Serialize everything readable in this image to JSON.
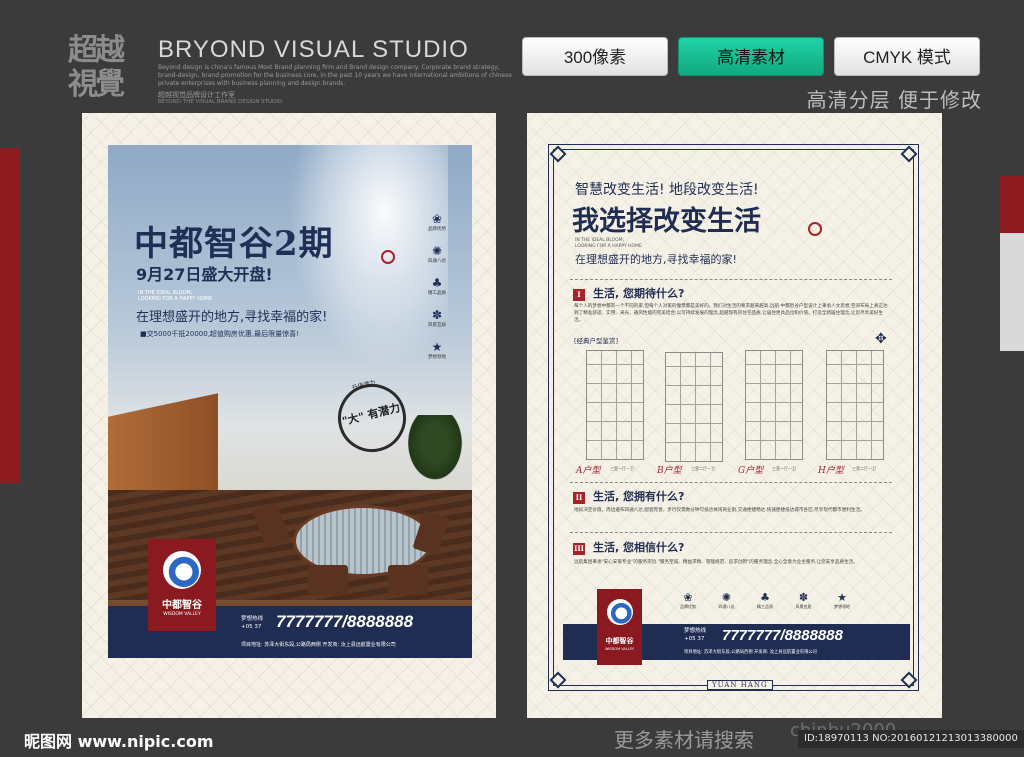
{
  "header": {
    "logo_text": "超越視覺",
    "studio_name": "BRYOND VISUAL STUDIO",
    "studio_desc": "Beyond design is china's famous Most Brand planning firm and Brand design company. Corporate brand strategy, brand-design, brand promotion for the business core, in the past 10 years we have international ambitions of chinese private enterprises with business planning and design brands.",
    "studio_cn": "超越视觉品牌设计工作室",
    "studio_en2": "BEYOND THE VISUAL BRAND DESIGN STUDIO",
    "buttons": [
      "300像素",
      "高清素材",
      "CMYK 模式"
    ],
    "tagline": "高清分层  便于修改"
  },
  "left_poster": {
    "title": "中都智谷2期",
    "subtitle": "9月27日盛大开盘!",
    "en": "IN THE IDEAL BLOOM,\nLOOKING FOR A HAPPY HOME",
    "slogan": "在理想盛开的地方,寻找幸福的家!",
    "small_text": "■交5000千抵20000,超值购房优惠,最后限量惊喜!",
    "icons": [
      {
        "glyph": "❀",
        "caption": "品牌优势"
      },
      {
        "glyph": "✺",
        "caption": "四通八达"
      },
      {
        "glyph": "♣",
        "caption": "精工品质"
      },
      {
        "glyph": "✽",
        "caption": "风景宜居"
      },
      {
        "glyph": "★",
        "caption": "梦想领地"
      }
    ],
    "stamp_top": "升值潜力",
    "stamp_main": "\"大\" 有潜力",
    "brand_cn": "中都智谷",
    "brand_en": "WISDOM VALLEY",
    "hotline_label": "梦想热线",
    "area_code": "+05 37",
    "phone": "7777777/8888888",
    "address": "项目地址:  苏泽大街东段,公路局西侧   开发商:  汝上县远航置业有限公司"
  },
  "right_poster": {
    "top_line": "智慧改变生活!  地段改变生活!",
    "title": "我选择改变生活",
    "en": "IN THE IDEAL BLOOM,\nLOOKING FOR A HAPPY HOME",
    "slogan": "在理想盛开的地方,寻找幸福的家!",
    "sections": [
      {
        "num": "I",
        "title": "生活,  您期待什么?",
        "text": "每个人的梦想中都有一个不同的家,但每个人对家的憧憬都是美好的。我们对生活的要求越来越高,远航·中都智谷户型设计上秉承人文思想,空间布局上真正达到了精准舒适、实用、采光、通风性能的完美结合,以可持续发展的理念,超越现有的住宅品质,让居住更具品位和价值。打造全新居住理念,让您尽享美好生活。"
      },
      {
        "num": "II",
        "title": "生活,  您拥有什么?",
        "text": "地段决定价值。周边遍布四通八达,配套完善。步行仅需数分钟可抵达休闲商业街,交通便捷畅达,快速便捷抵达城市各区,尽享现代都市便利生活。"
      },
      {
        "num": "III",
        "title": "生活,  您相信什么?",
        "text": "远航集团秉承\"安心安家专业\"的服务宗旨,\"服务至诚、精益求精、管理规范、追求创新\"的服务理念,全心全意为业主服务,让您安享品质生活。"
      }
    ],
    "floorplan_heading": "[经典户型鉴赏]",
    "floorplans": [
      {
        "label": "A户型",
        "spec": "三室一厅一卫"
      },
      {
        "label": "B户型",
        "spec": "三室二厅一卫"
      },
      {
        "label": "G户型",
        "spec": "三室一厅一卫"
      },
      {
        "label": "H户型",
        "spec": "三室二厅一卫"
      }
    ],
    "icons": [
      {
        "glyph": "❀",
        "caption": "品牌优势"
      },
      {
        "glyph": "✺",
        "caption": "四通八达"
      },
      {
        "glyph": "♣",
        "caption": "精工品质"
      },
      {
        "glyph": "✽",
        "caption": "风景宜居"
      },
      {
        "glyph": "★",
        "caption": "梦想领地"
      }
    ],
    "brand_cn": "中都智谷",
    "brand_en": "WISDOM VALLEY",
    "hotline_label": "梦想热线",
    "area_code": "+05 37",
    "phone": "7777777/8888888",
    "address": "项目地址:  苏泽大街东段,公路局西侧   开发商:  汝上县远航置业有限公司",
    "footer_mark": "YUAN HANG"
  },
  "footer": {
    "site": "昵图网 www.nipic.com",
    "search_text": "更多素材请搜索",
    "watermark": "chinhu2000",
    "id_line": "ID:18970113 NO:20160121213013380000"
  },
  "colors": {
    "navy": "#1f2d52",
    "wine": "#8b1a20",
    "green": "#12a880",
    "red": "#a5232a"
  }
}
